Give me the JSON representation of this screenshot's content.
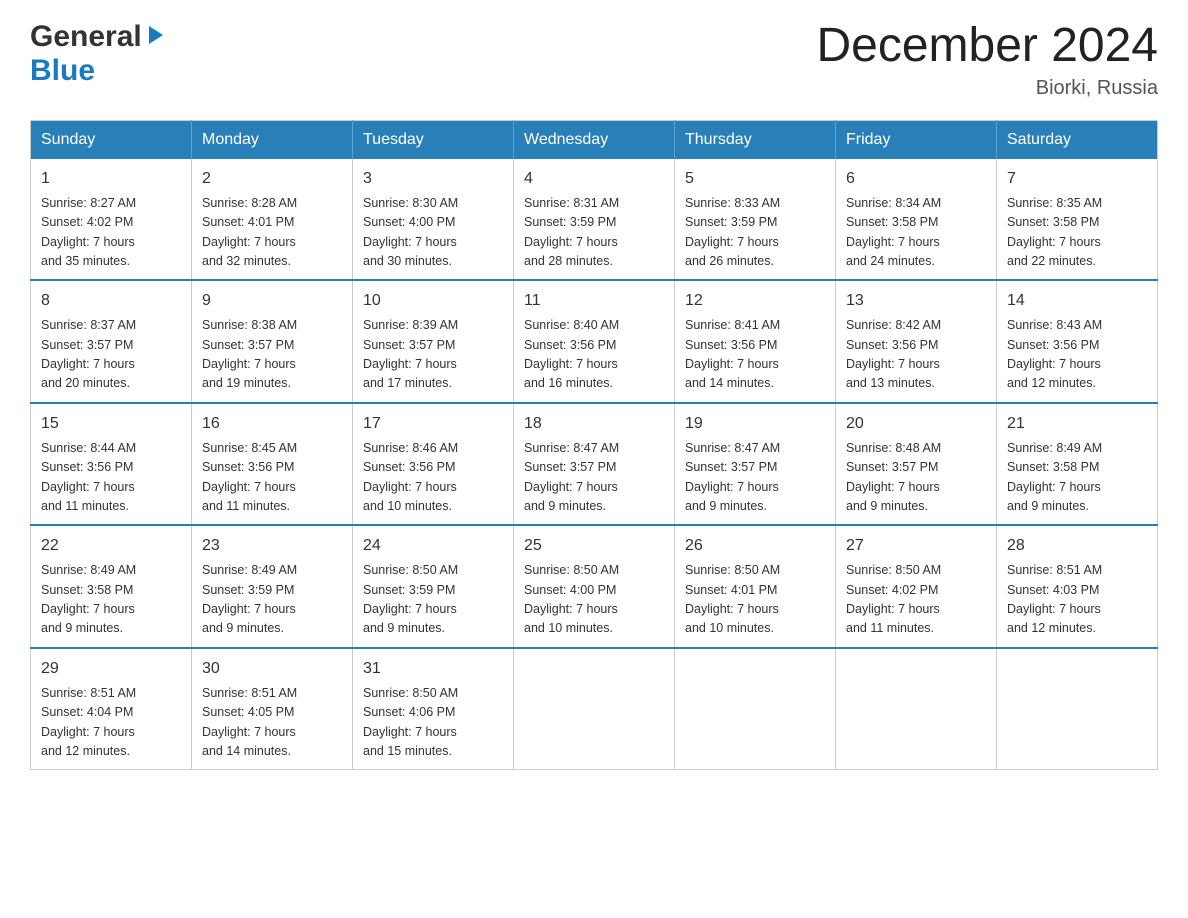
{
  "header": {
    "logo_general": "General",
    "logo_blue": "Blue",
    "month_title": "December 2024",
    "location": "Biorki, Russia"
  },
  "weekdays": [
    "Sunday",
    "Monday",
    "Tuesday",
    "Wednesday",
    "Thursday",
    "Friday",
    "Saturday"
  ],
  "weeks": [
    [
      {
        "day": "1",
        "sunrise": "8:27 AM",
        "sunset": "4:02 PM",
        "daylight": "7 hours and 35 minutes."
      },
      {
        "day": "2",
        "sunrise": "8:28 AM",
        "sunset": "4:01 PM",
        "daylight": "7 hours and 32 minutes."
      },
      {
        "day": "3",
        "sunrise": "8:30 AM",
        "sunset": "4:00 PM",
        "daylight": "7 hours and 30 minutes."
      },
      {
        "day": "4",
        "sunrise": "8:31 AM",
        "sunset": "3:59 PM",
        "daylight": "7 hours and 28 minutes."
      },
      {
        "day": "5",
        "sunrise": "8:33 AM",
        "sunset": "3:59 PM",
        "daylight": "7 hours and 26 minutes."
      },
      {
        "day": "6",
        "sunrise": "8:34 AM",
        "sunset": "3:58 PM",
        "daylight": "7 hours and 24 minutes."
      },
      {
        "day": "7",
        "sunrise": "8:35 AM",
        "sunset": "3:58 PM",
        "daylight": "7 hours and 22 minutes."
      }
    ],
    [
      {
        "day": "8",
        "sunrise": "8:37 AM",
        "sunset": "3:57 PM",
        "daylight": "7 hours and 20 minutes."
      },
      {
        "day": "9",
        "sunrise": "8:38 AM",
        "sunset": "3:57 PM",
        "daylight": "7 hours and 19 minutes."
      },
      {
        "day": "10",
        "sunrise": "8:39 AM",
        "sunset": "3:57 PM",
        "daylight": "7 hours and 17 minutes."
      },
      {
        "day": "11",
        "sunrise": "8:40 AM",
        "sunset": "3:56 PM",
        "daylight": "7 hours and 16 minutes."
      },
      {
        "day": "12",
        "sunrise": "8:41 AM",
        "sunset": "3:56 PM",
        "daylight": "7 hours and 14 minutes."
      },
      {
        "day": "13",
        "sunrise": "8:42 AM",
        "sunset": "3:56 PM",
        "daylight": "7 hours and 13 minutes."
      },
      {
        "day": "14",
        "sunrise": "8:43 AM",
        "sunset": "3:56 PM",
        "daylight": "7 hours and 12 minutes."
      }
    ],
    [
      {
        "day": "15",
        "sunrise": "8:44 AM",
        "sunset": "3:56 PM",
        "daylight": "7 hours and 11 minutes."
      },
      {
        "day": "16",
        "sunrise": "8:45 AM",
        "sunset": "3:56 PM",
        "daylight": "7 hours and 11 minutes."
      },
      {
        "day": "17",
        "sunrise": "8:46 AM",
        "sunset": "3:56 PM",
        "daylight": "7 hours and 10 minutes."
      },
      {
        "day": "18",
        "sunrise": "8:47 AM",
        "sunset": "3:57 PM",
        "daylight": "7 hours and 9 minutes."
      },
      {
        "day": "19",
        "sunrise": "8:47 AM",
        "sunset": "3:57 PM",
        "daylight": "7 hours and 9 minutes."
      },
      {
        "day": "20",
        "sunrise": "8:48 AM",
        "sunset": "3:57 PM",
        "daylight": "7 hours and 9 minutes."
      },
      {
        "day": "21",
        "sunrise": "8:49 AM",
        "sunset": "3:58 PM",
        "daylight": "7 hours and 9 minutes."
      }
    ],
    [
      {
        "day": "22",
        "sunrise": "8:49 AM",
        "sunset": "3:58 PM",
        "daylight": "7 hours and 9 minutes."
      },
      {
        "day": "23",
        "sunrise": "8:49 AM",
        "sunset": "3:59 PM",
        "daylight": "7 hours and 9 minutes."
      },
      {
        "day": "24",
        "sunrise": "8:50 AM",
        "sunset": "3:59 PM",
        "daylight": "7 hours and 9 minutes."
      },
      {
        "day": "25",
        "sunrise": "8:50 AM",
        "sunset": "4:00 PM",
        "daylight": "7 hours and 10 minutes."
      },
      {
        "day": "26",
        "sunrise": "8:50 AM",
        "sunset": "4:01 PM",
        "daylight": "7 hours and 10 minutes."
      },
      {
        "day": "27",
        "sunrise": "8:50 AM",
        "sunset": "4:02 PM",
        "daylight": "7 hours and 11 minutes."
      },
      {
        "day": "28",
        "sunrise": "8:51 AM",
        "sunset": "4:03 PM",
        "daylight": "7 hours and 12 minutes."
      }
    ],
    [
      {
        "day": "29",
        "sunrise": "8:51 AM",
        "sunset": "4:04 PM",
        "daylight": "7 hours and 12 minutes."
      },
      {
        "day": "30",
        "sunrise": "8:51 AM",
        "sunset": "4:05 PM",
        "daylight": "7 hours and 14 minutes."
      },
      {
        "day": "31",
        "sunrise": "8:50 AM",
        "sunset": "4:06 PM",
        "daylight": "7 hours and 15 minutes."
      },
      null,
      null,
      null,
      null
    ]
  ],
  "labels": {
    "sunrise": "Sunrise:",
    "sunset": "Sunset:",
    "daylight": "Daylight:"
  }
}
